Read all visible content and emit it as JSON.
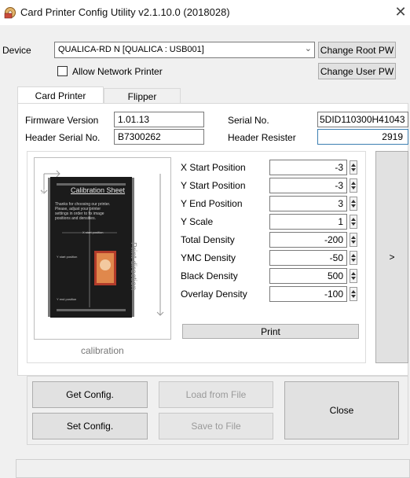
{
  "window": {
    "title": "Card Printer Config Utility v2.1.10.0 (2018028)",
    "close_glyph": "✕"
  },
  "device": {
    "label": "Device",
    "selected": "QUALICA-RD N  [QUALICA : USB001]",
    "allow_network_label": "Allow Network Printer",
    "allow_network_checked": false,
    "change_root_pw": "Change Root PW",
    "change_user_pw": "Change User PW"
  },
  "tabs": [
    {
      "label": "Card Printer",
      "active": true
    },
    {
      "label": "Flipper",
      "active": false
    }
  ],
  "info": {
    "firmware_label": "Firmware Version",
    "firmware_value": "1.01.13",
    "serial_label": "Serial No.",
    "serial_value": "5DID110300H41043",
    "header_serial_label": "Header Serial No.",
    "header_serial_value": "B7300262",
    "header_resister_label": "Header Resister",
    "header_resister_value": "2919"
  },
  "calibration": {
    "caption": "calibration",
    "sheet_title": "Calibration Sheet",
    "sheet_text": "Thanks for choosing our printer. Please, adjust your printer settings in order to fix image positions and densities.",
    "axis_x": "X",
    "axis_y": "Y",
    "direction_label": "Print direction",
    "x_start_small": "X start position",
    "y_start_small": "Y start position",
    "y_end_small": "Y end position"
  },
  "params": [
    {
      "label": "X Start Position",
      "value": "-3"
    },
    {
      "label": "Y Start Position",
      "value": "-3"
    },
    {
      "label": "Y End Position",
      "value": "3"
    },
    {
      "label": "Y Scale",
      "value": "1"
    },
    {
      "label": "Total Density",
      "value": "-200"
    },
    {
      "label": "YMC Density",
      "value": "-50"
    },
    {
      "label": "Black Density",
      "value": "500"
    },
    {
      "label": "Overlay Density",
      "value": "-100"
    }
  ],
  "buttons": {
    "print": "Print",
    "next": ">",
    "get_config": "Get Config.",
    "set_config": "Set Config.",
    "load_from_file": "Load from File",
    "save_to_file": "Save to File",
    "close": "Close"
  },
  "colors": {
    "accent_focus": "#3c7fb1",
    "disabled_text": "#9a9a9a"
  }
}
